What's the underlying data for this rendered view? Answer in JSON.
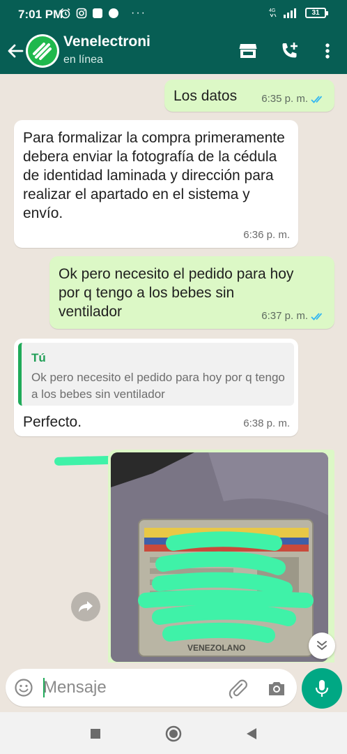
{
  "status_bar": {
    "time": "7:01 PM",
    "battery": "31",
    "network": "4G"
  },
  "header": {
    "contact_name": "Venelectroni",
    "status": "en línea",
    "icons": [
      "back-arrow-icon",
      "store-icon",
      "add-call-icon",
      "more-vert-icon"
    ]
  },
  "messages": [
    {
      "direction": "out",
      "text": "Los datos",
      "time": "6:35 p. m.",
      "read": true
    },
    {
      "direction": "in",
      "text": "Para formalizar la compra primeramente debera enviar la fotografía de la cédula de identidad laminada y dirección para realizar el apartado en el sistema y envío.",
      "time": "6:36 p. m."
    },
    {
      "direction": "out",
      "text": "Ok pero necesito el pedido para hoy por q tengo a los bebes sin ventilador",
      "time": "6:37 p. m.",
      "read": true
    },
    {
      "direction": "in",
      "quote_author": "Tú",
      "quote_text": "Ok pero necesito el pedido para hoy por q tengo a los bebes sin ventilador",
      "text": "Perfecto.",
      "time": "6:38 p. m."
    },
    {
      "direction": "out",
      "type": "image",
      "image_caption_text": "VENEZOLANO"
    }
  ],
  "input": {
    "placeholder": "Mensaje"
  },
  "colors": {
    "header": "#075e54",
    "outgoing_bubble": "#dcf8c6",
    "incoming_bubble": "#ffffff",
    "accent": "#00a884",
    "read_ticks": "#34b7f1",
    "redaction": "#3ff2a8"
  }
}
